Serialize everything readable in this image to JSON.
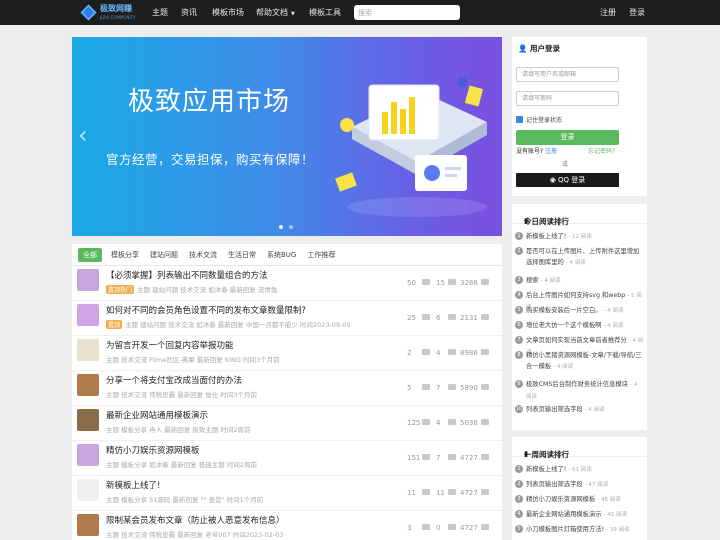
{
  "header": {
    "logo_text": "极致网赚",
    "logo_sub": "JIZHI COMMUNITY",
    "nav": [
      "主题",
      "资讯",
      "模板市场",
      "帮助文档",
      "模板工具"
    ],
    "nav_dropdown_index": 3,
    "search_placeholder": "搜索",
    "register": "注册",
    "login": "登录"
  },
  "banner": {
    "title": "极致应用市场",
    "subtitle": "官方经营，交易担保，购买有保障！",
    "dots": 2,
    "active_dot": 0
  },
  "tabs": [
    "全部",
    "模板分享",
    "建站问题",
    "技术交流",
    "生活日常",
    "系统BUG",
    "工作推荐"
  ],
  "active_tab": 0,
  "topics": [
    {
      "title": "【必须掌握】列表输出不同数量组合的方法",
      "badge": "置顶热门",
      "meta": "主题  建站问题  技术交流  如沐春  最新回复  流情兔",
      "views": "50",
      "comments": "15",
      "likes": "3286",
      "avatar": "#c9a7de"
    },
    {
      "title": "如何对不同的会员角色设置不同的发布文章数量限制?",
      "badge": "置顶",
      "meta": "主题  建站问题  技术交流  如沐春  最新回复  中国一点都不能少  时间2023-09-09",
      "views": "25",
      "comments": "6",
      "likes": "2131",
      "avatar": "#d0a2e6"
    },
    {
      "title": "为留言开发一个回复内容举报功能",
      "badge": "",
      "meta": "主题  技术交流  Filme社区-弗果  最新回复  KING  时间3个月前",
      "views": "2",
      "comments": "4",
      "likes": "8986",
      "avatar": "#e8e0d0"
    },
    {
      "title": "分享一个将支付宝改成当面付的办法",
      "badge": "",
      "meta": "主题  技术交流  伟税皮霸  最新回复  恤仕  时间3个月前",
      "views": "5",
      "comments": "7",
      "likes": "5890",
      "avatar": "#b07a4a"
    },
    {
      "title": "最新企业网站通用模板演示",
      "badge": "",
      "meta": "主题  模板分享  冉人  最新回复  极致主题  时间2周前",
      "views": "125",
      "comments": "4",
      "likes": "5038",
      "avatar": "#8a6b4a"
    },
    {
      "title": "精仿小刀娱乐资源网模板",
      "badge": "",
      "meta": "主题  模板分享  如沐春  最新回复  极速主题  时间2周前",
      "views": "151",
      "comments": "7",
      "likes": "4727",
      "avatar": "#c9a7de"
    },
    {
      "title": "新模板上线了!",
      "badge": "",
      "meta": "主题  模板分享  51源码  最新回复 \"\" 查您\"  时间1个月前",
      "views": "11",
      "comments": "11",
      "likes": "4727",
      "avatar": "#f0f0f0"
    },
    {
      "title": "限制某会员发布文章（防止被人恶意发布信息）",
      "badge": "",
      "meta": "主题  技术交流  伟税皮霸  最新回复  老爷007  时间2023-02-03",
      "views": "3",
      "comments": "0",
      "likes": "4727",
      "avatar": "#b07a4a"
    }
  ],
  "login_panel": {
    "title": "用户登录",
    "username_placeholder": "请填写用户名或邮箱",
    "password_placeholder": "请填写密码",
    "remember": "记住登录状态",
    "login_button": "登录",
    "no_account": "没有账号?",
    "register_link": "注册",
    "forgot": "忘记密码?",
    "or": "或",
    "qq_button": "QQ 登录"
  },
  "today_rank": {
    "title": "今日阅读排行",
    "items": [
      {
        "text": "新模板上线了!",
        "reads": "- 12 阅读"
      },
      {
        "text": "是否可以在上传图片、上传附件这里增加选择图库里的",
        "reads": "- 4 阅读"
      },
      {
        "text": "搜索",
        "reads": "- 4 阅读"
      },
      {
        "text": "后台上传图片如何支持svg 和webp",
        "reads": "- 5 阅读"
      },
      {
        "text": "购买模板安装后一片空白。",
        "reads": "- 4 阅读"
      },
      {
        "text": "增位老大仿一个这个模板啊",
        "reads": "- 4 阅读"
      },
      {
        "text": "文章页如何实现当前文章前者推荐分",
        "reads": "- 4 阅读"
      },
      {
        "text": "精仿小黑猪资源网模板-文章/下载/导航/三合一模板",
        "reads": "- 4 阅读"
      },
      {
        "text": "极致CMS后台制作财务统计信息模块",
        "reads": "- 4 阅读"
      },
      {
        "text": "列表页输出筛选字段",
        "reads": "- 4 阅读"
      }
    ]
  },
  "week_rank": {
    "title": "一周阅读排行",
    "items": [
      {
        "text": "新模板上线了!",
        "reads": "- 61 阅读"
      },
      {
        "text": "列表页输出筛选字段",
        "reads": "- 47 阅读"
      },
      {
        "text": "精仿小刀娱乐资源网模板",
        "reads": "- 45 阅读"
      },
      {
        "text": "最新企业网站通用模板演示",
        "reads": "- 45 阅读"
      },
      {
        "text": "小刀模板图片灯箱使用方法!",
        "reads": "- 39 阅读"
      }
    ]
  },
  "colors": {
    "accent": "#5cb85c",
    "topbar": "#1e1e1e",
    "link": "#3a86e0"
  }
}
